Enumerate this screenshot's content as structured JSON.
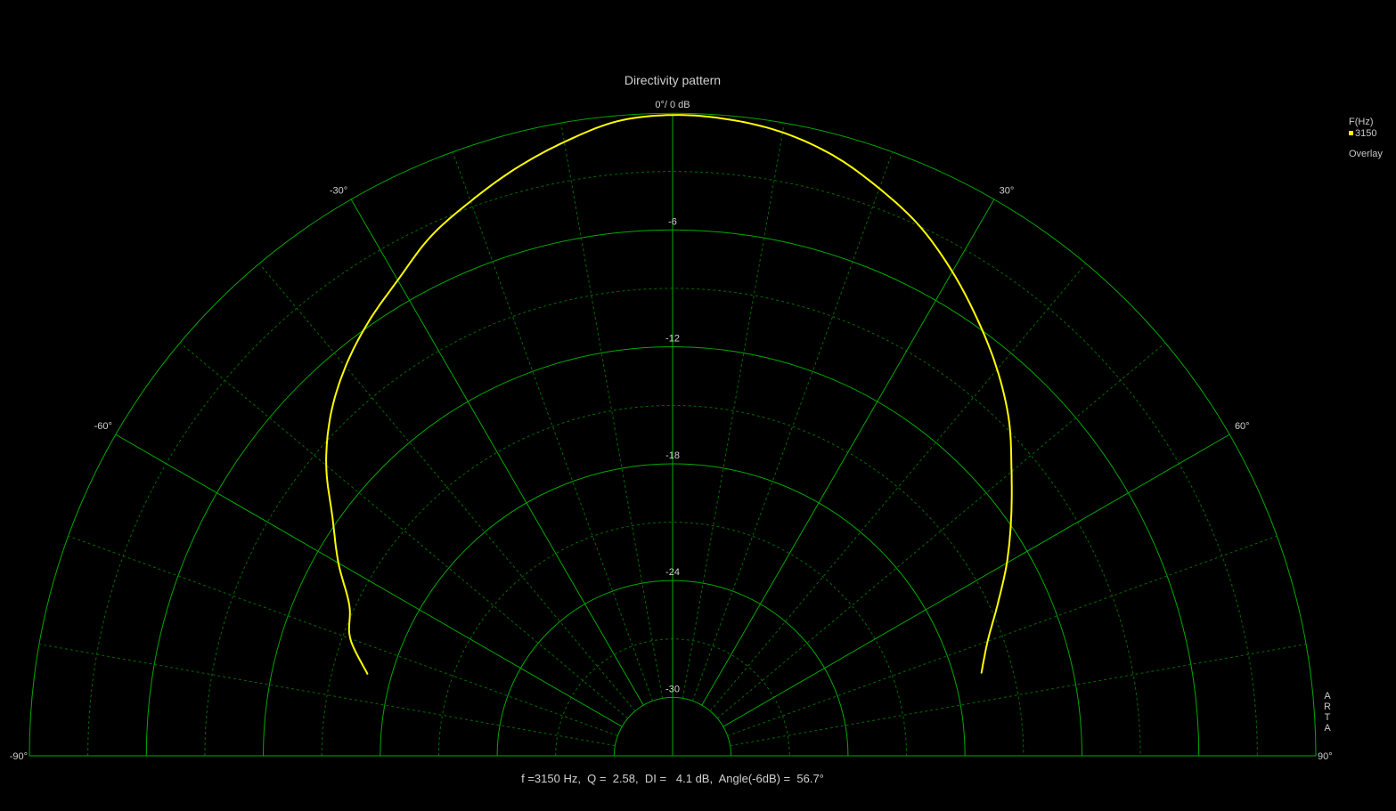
{
  "chart_data": {
    "type": "polar-line",
    "title": "Directivity pattern",
    "radial_axis": {
      "unit": "dB",
      "range": [
        -33,
        0
      ],
      "tick_labels": [
        "0°/ 0 dB",
        "-6",
        "-12",
        "-18",
        "-24",
        "-30"
      ],
      "tick_values": [
        0,
        -6,
        -12,
        -18,
        -24,
        -30
      ]
    },
    "angular_axis": {
      "range_deg": [
        -90,
        90
      ],
      "tick_labels": [
        "-90°",
        "-60°",
        "-30°",
        "30°",
        "60°",
        "90°"
      ],
      "tick_values": [
        -90,
        -60,
        -30,
        30,
        60,
        90
      ]
    },
    "grid": true,
    "legend": {
      "position": "right",
      "header": "F(Hz)",
      "footer": "Overlay"
    },
    "series": [
      {
        "name": "3150",
        "color": "#ffff00",
        "angles_deg": [
          -75,
          -70,
          -65,
          -60,
          -55,
          -50,
          -45,
          -40,
          -35,
          -30,
          -25,
          -20,
          -15,
          -10,
          -5,
          0,
          5,
          10,
          15,
          20,
          25,
          30,
          35,
          40,
          45,
          50,
          55,
          60,
          65,
          70,
          75
        ],
        "values_db": [
          -16.8,
          -15.4,
          -14.7,
          -13.2,
          -11.7,
          -9.8,
          -8.2,
          -6.9,
          -5.8,
          -4.8,
          -3.6,
          -2.7,
          -1.8,
          -1.0,
          -0.3,
          -0.1,
          -0.2,
          -0.5,
          -1.1,
          -2.0,
          -3.0,
          -4.3,
          -5.7,
          -7.1,
          -8.6,
          -10.3,
          -11.8,
          -13.2,
          -14.6,
          -15.8,
          -16.6
        ]
      }
    ],
    "colors": {
      "background": "#000000",
      "grid_major": "#00aa00",
      "grid_minor": "#006a00",
      "trace": "#ffff00",
      "text": "#d0d0d0"
    }
  },
  "info": {
    "text": "f =3150 Hz,  Q =  2.58,  DI =   4.1 dB,  Angle(-6dB) =  56.7°"
  },
  "brand": {
    "text": "ARTA"
  }
}
